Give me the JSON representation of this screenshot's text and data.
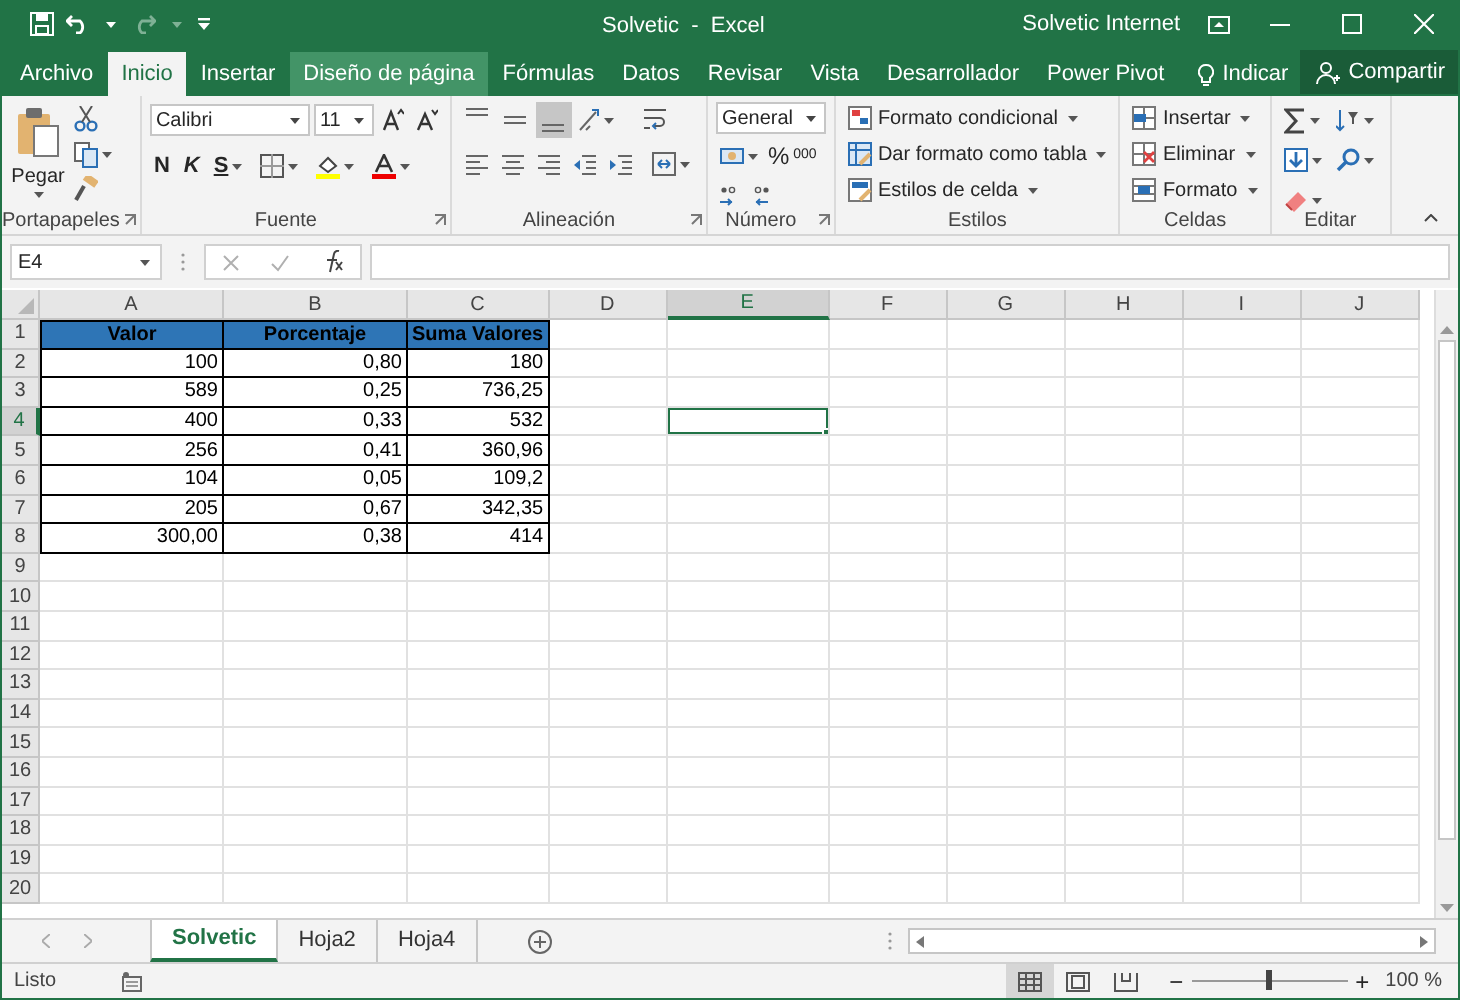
{
  "title_bar": {
    "title": "Solvetic  -  Excel",
    "account": "Solvetic Internet"
  },
  "tabs": [
    {
      "label": "Archivo",
      "selected": false,
      "hovered": false
    },
    {
      "label": "Inicio",
      "selected": true,
      "hovered": false
    },
    {
      "label": "Insertar",
      "selected": false,
      "hovered": false
    },
    {
      "label": "Diseño de página",
      "selected": false,
      "hovered": true
    },
    {
      "label": "Fórmulas",
      "selected": false,
      "hovered": false
    },
    {
      "label": "Datos",
      "selected": false,
      "hovered": false
    },
    {
      "label": "Revisar",
      "selected": false,
      "hovered": false
    },
    {
      "label": "Vista",
      "selected": false,
      "hovered": false
    },
    {
      "label": "Desarrollador",
      "selected": false,
      "hovered": false
    },
    {
      "label": "Power Pivot",
      "selected": false,
      "hovered": false
    }
  ],
  "tell_me": "Indicar",
  "share_button": "Compartir",
  "ribbon": {
    "clipboard": {
      "label": "Portapapeles",
      "paste": "Pegar"
    },
    "font": {
      "label": "Fuente",
      "font_name": "Calibri",
      "font_size": "11",
      "bold": "N",
      "italic": "K",
      "underline": "S"
    },
    "alignment": {
      "label": "Alineación",
      "vertical": [
        {
          "selected": false
        },
        {
          "selected": false
        },
        {
          "selected": true
        }
      ]
    },
    "number": {
      "label": "Número",
      "format": "General",
      "percent": "%",
      "thousands": "000"
    },
    "styles": {
      "label": "Estilos",
      "items": [
        "Formato condicional",
        "Dar formato como tabla",
        "Estilos de celda"
      ]
    },
    "cells": {
      "label": "Celdas",
      "items": [
        "Insertar",
        "Eliminar",
        "Formato"
      ]
    },
    "editing": {
      "label": "Editar"
    }
  },
  "formula_bar": {
    "name_box": "E4"
  },
  "sheet": {
    "columns": [
      {
        "label": "A",
        "selected": false
      },
      {
        "label": "B",
        "selected": false
      },
      {
        "label": "C",
        "selected": false
      },
      {
        "label": "D",
        "selected": false
      },
      {
        "label": "E",
        "selected": true
      },
      {
        "label": "F",
        "selected": false
      },
      {
        "label": "G",
        "selected": false
      },
      {
        "label": "H",
        "selected": false
      },
      {
        "label": "I",
        "selected": false
      },
      {
        "label": "J",
        "selected": false
      }
    ],
    "rows": [
      {
        "label": "1",
        "selected": false
      },
      {
        "label": "2",
        "selected": false
      },
      {
        "label": "3",
        "selected": false
      },
      {
        "label": "4",
        "selected": true
      },
      {
        "label": "5",
        "selected": false
      },
      {
        "label": "6",
        "selected": false
      },
      {
        "label": "7",
        "selected": false
      },
      {
        "label": "8",
        "selected": false
      },
      {
        "label": "9",
        "selected": false
      },
      {
        "label": "10",
        "selected": false
      },
      {
        "label": "11",
        "selected": false
      },
      {
        "label": "12",
        "selected": false
      },
      {
        "label": "13",
        "selected": false
      },
      {
        "label": "14",
        "selected": false
      },
      {
        "label": "15",
        "selected": false
      },
      {
        "label": "16",
        "selected": false
      },
      {
        "label": "17",
        "selected": false
      },
      {
        "label": "18",
        "selected": false
      },
      {
        "label": "19",
        "selected": false
      },
      {
        "label": "20",
        "selected": false
      }
    ],
    "table": {
      "header": [
        "Valor",
        "Porcentaje",
        "Suma Valores"
      ],
      "rows": [
        [
          "100",
          "0,80",
          "180"
        ],
        [
          "589",
          "0,25",
          "736,25"
        ],
        [
          "400",
          "0,33",
          "532"
        ],
        [
          "256",
          "0,41",
          "360,96"
        ],
        [
          "104",
          "0,05",
          "109,2"
        ],
        [
          "205",
          "0,67",
          "342,35"
        ],
        [
          "300,00",
          "0,38",
          "414"
        ]
      ]
    }
  },
  "sheet_tabs": [
    {
      "label": "Solvetic",
      "selected": true
    },
    {
      "label": "Hoja2",
      "selected": false
    },
    {
      "label": "Hoja4",
      "selected": false
    }
  ],
  "status_bar": {
    "status": "Listo",
    "views": [
      {
        "selected": true
      },
      {
        "selected": false
      },
      {
        "selected": false
      }
    ],
    "zoom": {
      "out": "−",
      "in": "+",
      "level": 0.5,
      "reading": "100 %"
    }
  }
}
